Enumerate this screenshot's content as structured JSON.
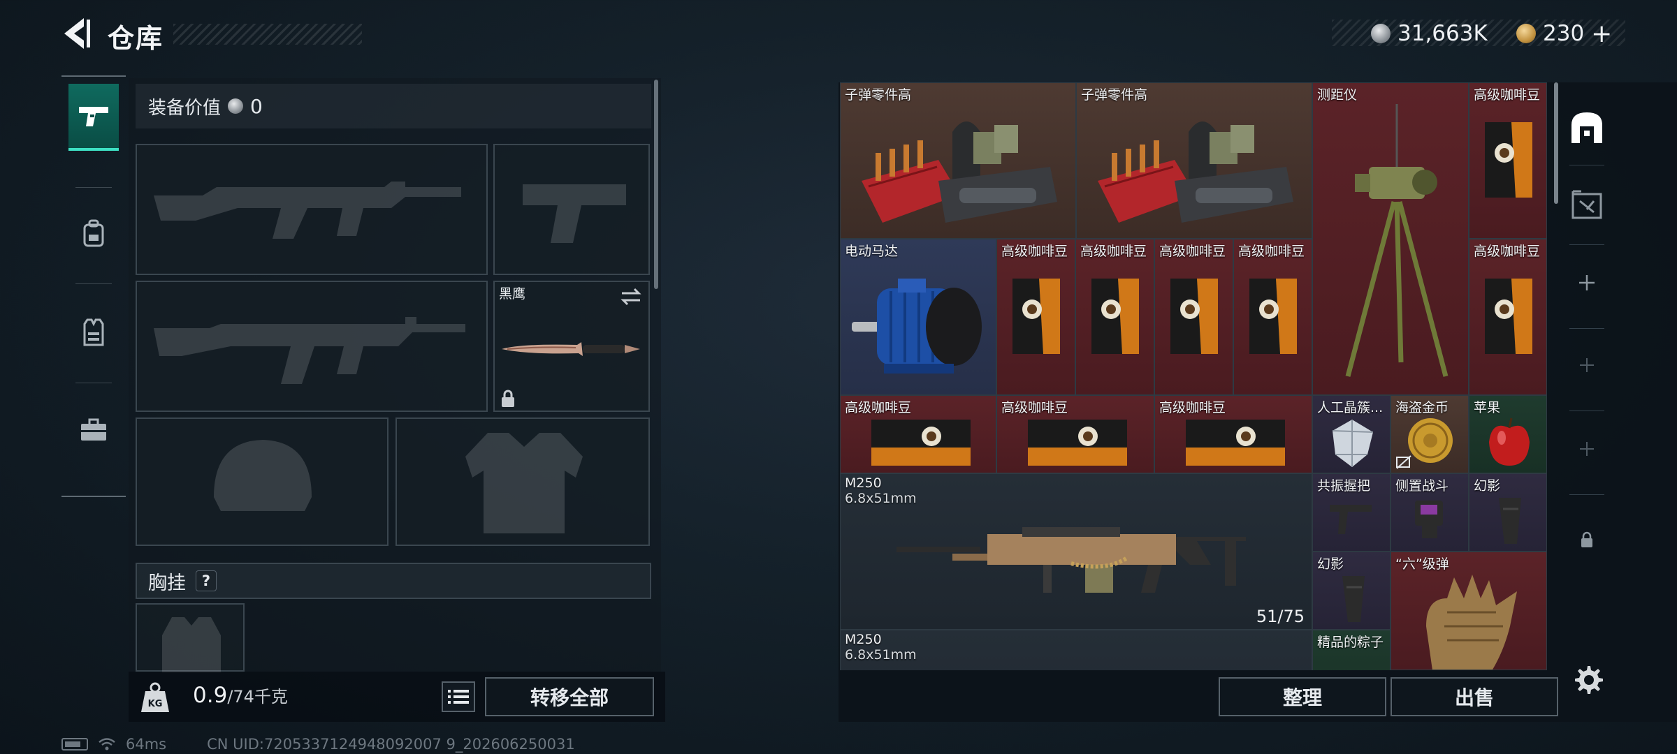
{
  "header": {
    "title": "仓库",
    "back_icon": "back-arrow-icon"
  },
  "currency": {
    "silver": "31,663K",
    "gold": "230",
    "add_label": "+"
  },
  "side_nav": [
    "pistol-icon",
    "backpack-icon",
    "vest-icon",
    "toolbox-icon"
  ],
  "equipment": {
    "value_label": "装备价值",
    "value": "0",
    "melee_name": "黑鹰",
    "chest_label": "胸挂",
    "help": "?"
  },
  "capacity": {
    "current": "0.9",
    "max": "/74千克",
    "weight_icon_text": "KG"
  },
  "buttons": {
    "transfer_all": "转移全部",
    "sort": "整理",
    "sell": "出售"
  },
  "status": {
    "ping": "64ms",
    "uid": "CN UID:7205337124948092007 9_202606250031"
  },
  "storage": {
    "items": [
      {
        "name": "子弹零件高"
      },
      {
        "name": "子弹零件高"
      },
      {
        "name": "测距仪"
      },
      {
        "name": "高级咖啡豆"
      },
      {
        "name": "电动马达"
      },
      {
        "name": "高级咖啡豆"
      },
      {
        "name": "高级咖啡豆"
      },
      {
        "name": "高级咖啡豆"
      },
      {
        "name": "高级咖啡豆"
      },
      {
        "name": "高级咖啡豆"
      },
      {
        "name": "高级咖啡豆"
      },
      {
        "name": "高级咖啡豆"
      },
      {
        "name": "高级咖啡豆"
      },
      {
        "name": "人工晶簇..."
      },
      {
        "name": "海盗金币"
      },
      {
        "name": "苹果"
      },
      {
        "name": "M250",
        "sub": "6.8x51mm",
        "count": "51/75"
      },
      {
        "name": "共振握把"
      },
      {
        "name": "侧置战斗"
      },
      {
        "name": "幻影"
      },
      {
        "name": "幻影"
      },
      {
        "name": "“六”级弹"
      },
      {
        "name": "M250",
        "sub": "6.8x51mm"
      },
      {
        "name": "精品的粽子"
      }
    ]
  },
  "right_strip": [
    "storage-vault-icon",
    "inventory-scan-icon",
    "add-icon",
    "add-icon",
    "add-icon",
    "lock-icon"
  ],
  "colors": {
    "accent": "#3ee0c4",
    "rarity_red": "#5b2328",
    "rarity_blue": "#2f3a58",
    "rarity_green": "#1f3b2e",
    "rarity_brown": "#4e3a32"
  }
}
